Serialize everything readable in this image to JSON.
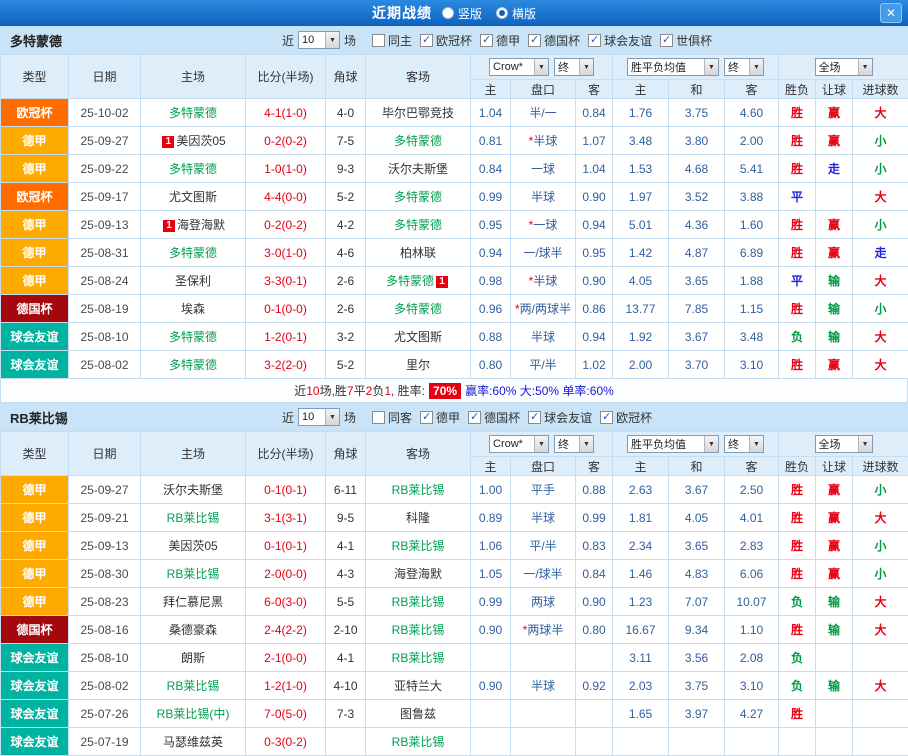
{
  "header": {
    "title": "近期战绩",
    "view_options": [
      {
        "label": "竖版",
        "selected": false
      },
      {
        "label": "横版",
        "selected": true
      }
    ]
  },
  "icons": {
    "close": "✕",
    "dropdown_arrow": "▼",
    "check": "✓"
  },
  "colors": {
    "league": {
      "欧冠杯": "#ff6c00",
      "德甲": "#ffaa00",
      "德国杯": "#a3080d",
      "球会友谊": "#00b2a0"
    },
    "result": {
      "胜": "#e60012",
      "平": "#2222dd",
      "负": "#009944",
      "赢": "#e60012",
      "走": "#2222dd",
      "输": "#009944",
      "大": "#e60012",
      "小": "#009944"
    },
    "team_highlight": "#00a050",
    "score": "#e60012",
    "odds": "#31609f",
    "badge": "#e60012"
  },
  "table_headers": {
    "type": "类型",
    "date": "日期",
    "home": "主场",
    "score": "比分(半场)",
    "corner": "角球",
    "away": "客场",
    "odds_provider": "Crow*",
    "odds_stage": "终",
    "avg_label": "胜平负均值",
    "avg_stage": "终",
    "scope": "全场",
    "odds_sub": [
      "主",
      "盘口",
      "客"
    ],
    "avg_sub": [
      "主",
      "和",
      "客"
    ],
    "result_sub": [
      "胜负",
      "让球",
      "进球数"
    ]
  },
  "sections": [
    {
      "team": "多特蒙德",
      "filter": {
        "near": "近",
        "count": "10",
        "games": "场",
        "same": {
          "label": "同主",
          "checked": false
        },
        "leagues": [
          {
            "label": "欧冠杯",
            "checked": true
          },
          {
            "label": "德甲",
            "checked": true
          },
          {
            "label": "德国杯",
            "checked": true
          },
          {
            "label": "球会友谊",
            "checked": true
          },
          {
            "label": "世俱杯",
            "checked": true
          }
        ]
      },
      "rows": [
        {
          "type": "欧冠杯",
          "date": "25-10-02",
          "home": {
            "name": "多特蒙德",
            "hl": true
          },
          "score": "4-1(1-0)",
          "corner": "4-0",
          "away": {
            "name": "毕尔巴鄂竞技",
            "hl": false
          },
          "odds": [
            "1.04",
            "半/一",
            "0.84"
          ],
          "avg": [
            "1.76",
            "3.75",
            "4.60"
          ],
          "res": [
            "胜",
            "赢",
            "大"
          ]
        },
        {
          "type": "德甲",
          "date": "25-09-27",
          "home": {
            "name": "美因茨05",
            "hl": false,
            "badge": "1",
            "badge_pos": "before"
          },
          "score": "0-2(0-2)",
          "corner": "7-5",
          "away": {
            "name": "多特蒙德",
            "hl": true
          },
          "odds": [
            "0.81",
            "*半球",
            "1.07"
          ],
          "avg": [
            "3.48",
            "3.80",
            "2.00"
          ],
          "res": [
            "胜",
            "赢",
            "小"
          ]
        },
        {
          "type": "德甲",
          "date": "25-09-22",
          "home": {
            "name": "多特蒙德",
            "hl": true
          },
          "score": "1-0(1-0)",
          "corner": "9-3",
          "away": {
            "name": "沃尔夫斯堡",
            "hl": false
          },
          "odds": [
            "0.84",
            "一球",
            "1.04"
          ],
          "avg": [
            "1.53",
            "4.68",
            "5.41"
          ],
          "res": [
            "胜",
            "走",
            "小"
          ]
        },
        {
          "type": "欧冠杯",
          "date": "25-09-17",
          "home": {
            "name": "尤文图斯",
            "hl": false
          },
          "score": "4-4(0-0)",
          "corner": "5-2",
          "away": {
            "name": "多特蒙德",
            "hl": true
          },
          "odds": [
            "0.99",
            "半球",
            "0.90"
          ],
          "avg": [
            "1.97",
            "3.52",
            "3.88"
          ],
          "res": [
            "平",
            "",
            "大"
          ]
        },
        {
          "type": "德甲",
          "date": "25-09-13",
          "home": {
            "name": "海登海默",
            "hl": false,
            "badge": "1",
            "badge_pos": "before"
          },
          "score": "0-2(0-2)",
          "corner": "4-2",
          "away": {
            "name": "多特蒙德",
            "hl": true
          },
          "odds": [
            "0.95",
            "*一球",
            "0.94"
          ],
          "avg": [
            "5.01",
            "4.36",
            "1.60"
          ],
          "res": [
            "胜",
            "赢",
            "小"
          ]
        },
        {
          "type": "德甲",
          "date": "25-08-31",
          "home": {
            "name": "多特蒙德",
            "hl": true
          },
          "score": "3-0(1-0)",
          "corner": "4-6",
          "away": {
            "name": "柏林联",
            "hl": false
          },
          "odds": [
            "0.94",
            "一/球半",
            "0.95"
          ],
          "avg": [
            "1.42",
            "4.87",
            "6.89"
          ],
          "res": [
            "胜",
            "赢",
            "走"
          ]
        },
        {
          "type": "德甲",
          "date": "25-08-24",
          "home": {
            "name": "圣保利",
            "hl": false
          },
          "score": "3-3(0-1)",
          "corner": "2-6",
          "away": {
            "name": "多特蒙德",
            "hl": true,
            "badge": "1",
            "badge_pos": "after"
          },
          "odds": [
            "0.98",
            "*半球",
            "0.90"
          ],
          "avg": [
            "4.05",
            "3.65",
            "1.88"
          ],
          "res": [
            "平",
            "输",
            "大"
          ]
        },
        {
          "type": "德国杯",
          "date": "25-08-19",
          "home": {
            "name": "埃森",
            "hl": false
          },
          "score": "0-1(0-0)",
          "corner": "2-6",
          "away": {
            "name": "多特蒙德",
            "hl": true
          },
          "odds": [
            "0.96",
            "*两/两球半",
            "0.86"
          ],
          "avg": [
            "13.77",
            "7.85",
            "1.15"
          ],
          "res": [
            "胜",
            "输",
            "小"
          ]
        },
        {
          "type": "球会友谊",
          "date": "25-08-10",
          "home": {
            "name": "多特蒙德",
            "hl": true
          },
          "score": "1-2(0-1)",
          "corner": "3-2",
          "away": {
            "name": "尤文图斯",
            "hl": false
          },
          "odds": [
            "0.88",
            "半球",
            "0.94"
          ],
          "avg": [
            "1.92",
            "3.67",
            "3.48"
          ],
          "res": [
            "负",
            "输",
            "大"
          ]
        },
        {
          "type": "球会友谊",
          "date": "25-08-02",
          "home": {
            "name": "多特蒙德",
            "hl": true
          },
          "score": "3-2(2-0)",
          "corner": "5-2",
          "away": {
            "name": "里尔",
            "hl": false
          },
          "odds": [
            "0.80",
            "平/半",
            "1.02"
          ],
          "avg": [
            "2.00",
            "3.70",
            "3.10"
          ],
          "res": [
            "胜",
            "赢",
            "大"
          ]
        }
      ],
      "summary": {
        "parts": [
          {
            "text": "近",
            "color": "#333333"
          },
          {
            "text": "10",
            "color": "#e60012"
          },
          {
            "text": "场,胜",
            "color": "#333333"
          },
          {
            "text": "7",
            "color": "#e60012"
          },
          {
            "text": "平",
            "color": "#333333"
          },
          {
            "text": "2",
            "color": "#e60012"
          },
          {
            "text": "负",
            "color": "#333333"
          },
          {
            "text": "1",
            "color": "#e60012"
          },
          {
            "text": ", 胜率:",
            "color": "#333333"
          }
        ],
        "rate_badge": "70%",
        "tail": "赢率:60% 大:50% 单率:60%",
        "tail_color": "#1616d9"
      }
    },
    {
      "team": "RB莱比锡",
      "filter": {
        "near": "近",
        "count": "10",
        "games": "场",
        "same": {
          "label": "同客",
          "checked": false
        },
        "leagues": [
          {
            "label": "德甲",
            "checked": true
          },
          {
            "label": "德国杯",
            "checked": true
          },
          {
            "label": "球会友谊",
            "checked": true
          },
          {
            "label": "欧冠杯",
            "checked": true
          }
        ]
      },
      "rows": [
        {
          "type": "德甲",
          "date": "25-09-27",
          "home": {
            "name": "沃尔夫斯堡",
            "hl": false
          },
          "score": "0-1(0-1)",
          "corner": "6-11",
          "away": {
            "name": "RB莱比锡",
            "hl": true
          },
          "odds": [
            "1.00",
            "平手",
            "0.88"
          ],
          "avg": [
            "2.63",
            "3.67",
            "2.50"
          ],
          "res": [
            "胜",
            "赢",
            "小"
          ]
        },
        {
          "type": "德甲",
          "date": "25-09-21",
          "home": {
            "name": "RB莱比锡",
            "hl": true
          },
          "score": "3-1(3-1)",
          "corner": "9-5",
          "away": {
            "name": "科隆",
            "hl": false
          },
          "odds": [
            "0.89",
            "半球",
            "0.99"
          ],
          "avg": [
            "1.81",
            "4.05",
            "4.01"
          ],
          "res": [
            "胜",
            "赢",
            "大"
          ]
        },
        {
          "type": "德甲",
          "date": "25-09-13",
          "home": {
            "name": "美因茨05",
            "hl": false
          },
          "score": "0-1(0-1)",
          "corner": "4-1",
          "away": {
            "name": "RB莱比锡",
            "hl": true
          },
          "odds": [
            "1.06",
            "平/半",
            "0.83"
          ],
          "avg": [
            "2.34",
            "3.65",
            "2.83"
          ],
          "res": [
            "胜",
            "赢",
            "小"
          ]
        },
        {
          "type": "德甲",
          "date": "25-08-30",
          "home": {
            "name": "RB莱比锡",
            "hl": true
          },
          "score": "2-0(0-0)",
          "corner": "4-3",
          "away": {
            "name": "海登海默",
            "hl": false
          },
          "odds": [
            "1.05",
            "一/球半",
            "0.84"
          ],
          "avg": [
            "1.46",
            "4.83",
            "6.06"
          ],
          "res": [
            "胜",
            "赢",
            "小"
          ]
        },
        {
          "type": "德甲",
          "date": "25-08-23",
          "home": {
            "name": "拜仁慕尼黑",
            "hl": false
          },
          "score": "6-0(3-0)",
          "corner": "5-5",
          "away": {
            "name": "RB莱比锡",
            "hl": true
          },
          "odds": [
            "0.99",
            "两球",
            "0.90"
          ],
          "avg": [
            "1.23",
            "7.07",
            "10.07"
          ],
          "res": [
            "负",
            "输",
            "大"
          ]
        },
        {
          "type": "德国杯",
          "date": "25-08-16",
          "home": {
            "name": "桑德豪森",
            "hl": false
          },
          "score": "2-4(2-2)",
          "corner": "2-10",
          "away": {
            "name": "RB莱比锡",
            "hl": true
          },
          "odds": [
            "0.90",
            "*两球半",
            "0.80"
          ],
          "avg": [
            "16.67",
            "9.34",
            "1.10"
          ],
          "res": [
            "胜",
            "输",
            "大"
          ]
        },
        {
          "type": "球会友谊",
          "date": "25-08-10",
          "home": {
            "name": "朗斯",
            "hl": false
          },
          "score": "2-1(0-0)",
          "corner": "4-1",
          "away": {
            "name": "RB莱比锡",
            "hl": true
          },
          "odds": [
            "",
            "",
            ""
          ],
          "avg": [
            "3.11",
            "3.56",
            "2.08"
          ],
          "res": [
            "负",
            "",
            ""
          ]
        },
        {
          "type": "球会友谊",
          "date": "25-08-02",
          "home": {
            "name": "RB莱比锡",
            "hl": true
          },
          "score": "1-2(1-0)",
          "corner": "4-10",
          "away": {
            "name": "亚特兰大",
            "hl": false
          },
          "odds": [
            "0.90",
            "半球",
            "0.92"
          ],
          "avg": [
            "2.03",
            "3.75",
            "3.10"
          ],
          "res": [
            "负",
            "输",
            "大"
          ]
        },
        {
          "type": "球会友谊",
          "date": "25-07-26",
          "home": {
            "name": "RB莱比锡(中)",
            "hl": true
          },
          "score": "7-0(5-0)",
          "corner": "7-3",
          "away": {
            "name": "图鲁兹",
            "hl": false
          },
          "odds": [
            "",
            "",
            ""
          ],
          "avg": [
            "1.65",
            "3.97",
            "4.27"
          ],
          "res": [
            "胜",
            "",
            ""
          ]
        },
        {
          "type": "球会友谊",
          "date": "25-07-19",
          "home": {
            "name": "马瑟维兹英",
            "hl": false
          },
          "score": "0-3(0-2)",
          "corner": "",
          "away": {
            "name": "RB莱比锡",
            "hl": true
          },
          "odds": [
            "",
            "",
            ""
          ],
          "avg": [
            "",
            "",
            ""
          ],
          "res": [
            "",
            "",
            ""
          ]
        }
      ]
    }
  ]
}
